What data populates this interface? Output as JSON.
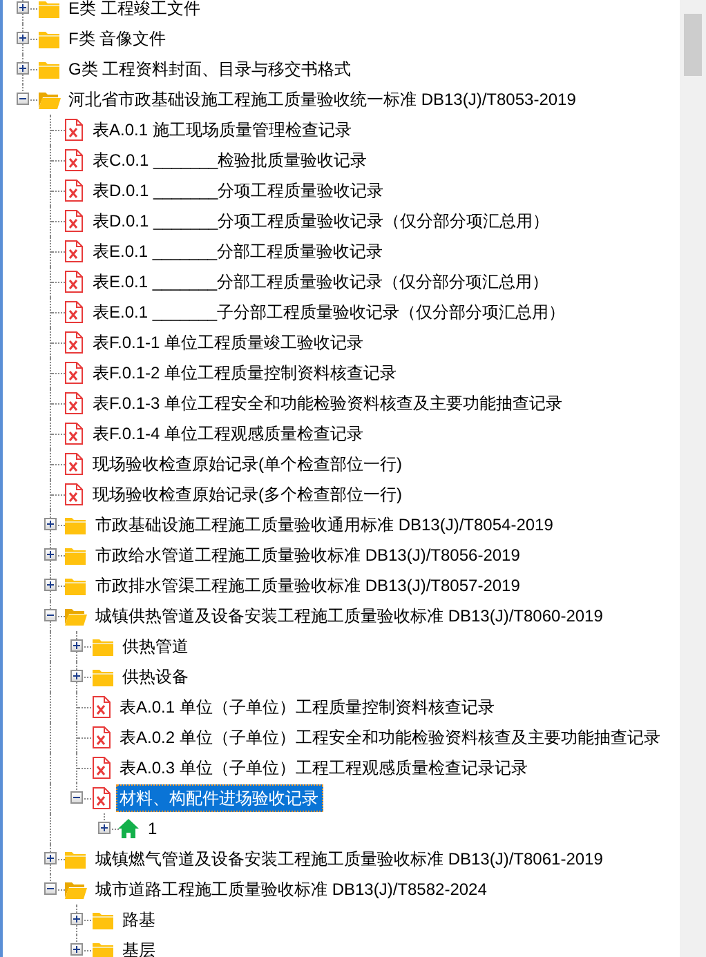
{
  "tree": [
    {
      "label": "E类 工程竣工文件",
      "kind": "folder",
      "expanded": false,
      "selected": false
    },
    {
      "label": "F类 音像文件",
      "kind": "folder",
      "expanded": false,
      "selected": false
    },
    {
      "label": "G类 工程资料封面、目录与移交书格式",
      "kind": "folder",
      "expanded": false,
      "selected": false
    },
    {
      "label": "河北省市政基础设施工程施工质量验收统一标准 DB13(J)/T8053-2019",
      "kind": "folder",
      "expanded": true,
      "selected": false,
      "children": [
        {
          "label": "表A.0.1 施工现场质量管理检查记录",
          "kind": "file",
          "selected": false
        },
        {
          "label": "表C.0.1 _______检验批质量验收记录",
          "kind": "file",
          "selected": false
        },
        {
          "label": "表D.0.1 _______分项工程质量验收记录",
          "kind": "file",
          "selected": false
        },
        {
          "label": "表D.0.1 _______分项工程质量验收记录（仅分部分项汇总用）",
          "kind": "file",
          "selected": false
        },
        {
          "label": "表E.0.1 _______分部工程质量验收记录",
          "kind": "file",
          "selected": false
        },
        {
          "label": "表E.0.1 _______分部工程质量验收记录（仅分部分项汇总用）",
          "kind": "file",
          "selected": false
        },
        {
          "label": "表E.0.1 _______子分部工程质量验收记录（仅分部分项汇总用）",
          "kind": "file",
          "selected": false
        },
        {
          "label": "表F.0.1-1 单位工程质量竣工验收记录",
          "kind": "file",
          "selected": false
        },
        {
          "label": "表F.0.1-2 单位工程质量控制资料核查记录",
          "kind": "file",
          "selected": false
        },
        {
          "label": "表F.0.1-3 单位工程安全和功能检验资料核查及主要功能抽查记录",
          "kind": "file",
          "selected": false
        },
        {
          "label": "表F.0.1-4 单位工程观感质量检查记录",
          "kind": "file",
          "selected": false
        },
        {
          "label": "现场验收检查原始记录(单个检查部位一行)",
          "kind": "file",
          "selected": false
        },
        {
          "label": "现场验收检查原始记录(多个检查部位一行)",
          "kind": "file",
          "selected": false
        },
        {
          "label": "市政基础设施工程施工质量验收通用标准 DB13(J)/T8054-2019",
          "kind": "folder",
          "expanded": false,
          "selected": false
        },
        {
          "label": "市政给水管道工程施工质量验收标准 DB13(J)/T8056-2019",
          "kind": "folder",
          "expanded": false,
          "selected": false
        },
        {
          "label": "市政排水管渠工程施工质量验收标准 DB13(J)/T8057-2019",
          "kind": "folder",
          "expanded": false,
          "selected": false
        },
        {
          "label": "城镇供热管道及设备安装工程施工质量验收标准 DB13(J)/T8060-2019",
          "kind": "folder",
          "expanded": true,
          "selected": false,
          "children": [
            {
              "label": "供热管道",
              "kind": "folder",
              "expanded": false,
              "selected": false
            },
            {
              "label": "供热设备",
              "kind": "folder",
              "expanded": false,
              "selected": false
            },
            {
              "label": "表A.0.1 单位（子单位）工程质量控制资料核查记录",
              "kind": "file",
              "selected": false
            },
            {
              "label": "表A.0.2 单位（子单位）工程安全和功能检验资料核查及主要功能抽查记录",
              "kind": "file",
              "selected": false
            },
            {
              "label": "表A.0.3 单位（子单位）工程工程观感质量检查记录记录",
              "kind": "file",
              "selected": false
            },
            {
              "label": "材料、构配件进场验收记录",
              "kind": "file",
              "expanded": true,
              "selected": true,
              "children": [
                {
                  "label": "1",
                  "kind": "home",
                  "expanded": false,
                  "selected": false
                }
              ]
            }
          ]
        },
        {
          "label": "城镇燃气管道及设备安装工程施工质量验收标准 DB13(J)/T8061-2019",
          "kind": "folder",
          "expanded": false,
          "selected": false
        },
        {
          "label": "城市道路工程施工质量验收标准 DB13(J)/T8582-2024",
          "kind": "folder",
          "expanded": true,
          "selected": false,
          "children": [
            {
              "label": "路基",
              "kind": "folder",
              "expanded": false,
              "selected": false
            },
            {
              "label": "基层",
              "kind": "folder",
              "expanded": false,
              "selected": false
            }
          ]
        }
      ]
    }
  ]
}
